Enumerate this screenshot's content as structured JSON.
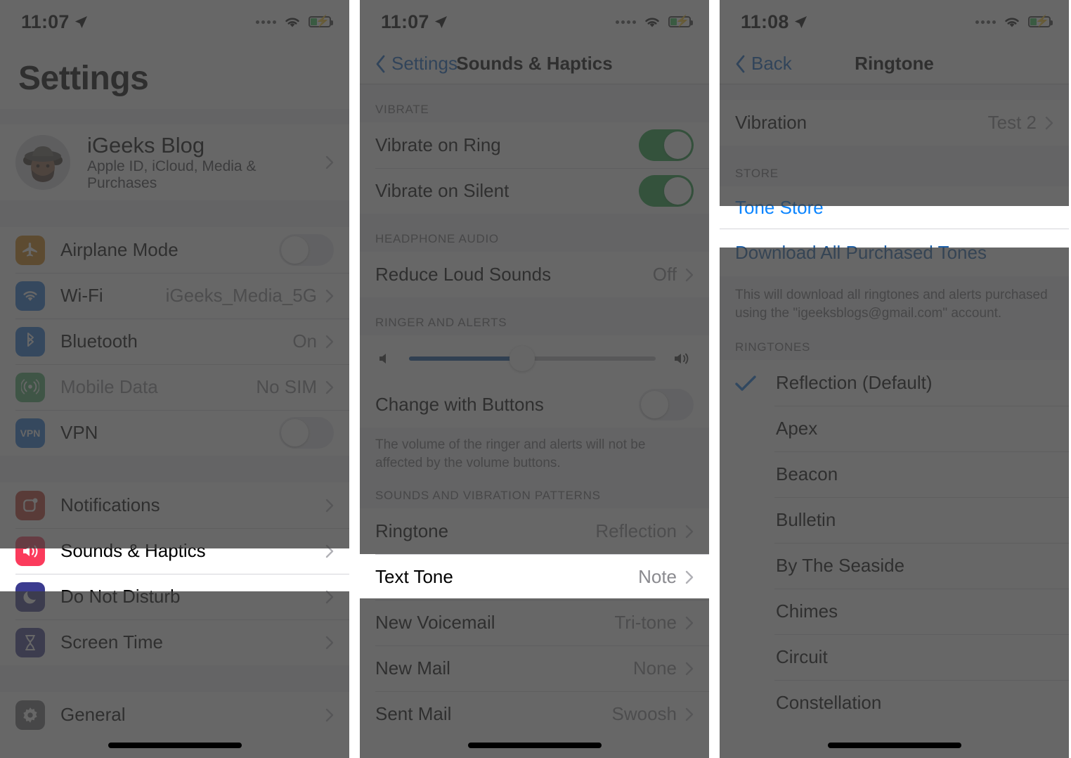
{
  "panels": [
    {
      "id": "settings",
      "status": {
        "time": "11:07",
        "location_icon": "location-arrow-icon",
        "wifi_icon": "wifi-icon",
        "battery_icon": "battery-charging-icon"
      },
      "title": "Settings",
      "account": {
        "name": "iGeeks Blog",
        "subtitle": "Apple ID, iCloud, Media & Purchases",
        "avatar": "memoji-avatar"
      },
      "group1": [
        {
          "label": "Airplane Mode",
          "icon": "airplane-icon",
          "icon_color": "#d2820a",
          "control": "toggle",
          "on": false
        },
        {
          "label": "Wi-Fi",
          "icon": "wifi-icon",
          "icon_color": "#1b72d6",
          "value": "iGeeks_Media_5G",
          "control": "chevron"
        },
        {
          "label": "Bluetooth",
          "icon": "bluetooth-icon",
          "icon_color": "#1b72d6",
          "value": "On",
          "control": "chevron"
        },
        {
          "label": "Mobile Data",
          "icon": "cellular-icon",
          "icon_color": "#4cae6a",
          "value": "No SIM",
          "control": "chevron",
          "disabled": true
        },
        {
          "label": "VPN",
          "icon": "vpn-icon",
          "icon_color": "#1b72d6",
          "control": "toggle",
          "on": false
        }
      ],
      "group2": [
        {
          "label": "Notifications",
          "icon": "notifications-icon",
          "icon_color": "#c0392b",
          "control": "chevron"
        },
        {
          "label": "Sounds & Haptics",
          "icon": "sounds-icon",
          "icon_color": "#fb3b5c",
          "control": "chevron",
          "highlighted": true
        },
        {
          "label": "Do Not Disturb",
          "icon": "moon-icon",
          "icon_color": "#3b3b8f",
          "control": "chevron"
        },
        {
          "label": "Screen Time",
          "icon": "hourglass-icon",
          "icon_color": "#3b3b8f",
          "control": "chevron"
        }
      ],
      "group3": [
        {
          "label": "General",
          "icon": "gear-icon",
          "icon_color": "#6d6d72",
          "control": "chevron"
        }
      ]
    },
    {
      "id": "sounds-haptics",
      "status": {
        "time": "11:07"
      },
      "back_label": "Settings",
      "title": "Sounds & Haptics",
      "sections": [
        {
          "header": "VIBRATE",
          "rows": [
            {
              "label": "Vibrate on Ring",
              "control": "toggle",
              "on": true
            },
            {
              "label": "Vibrate on Silent",
              "control": "toggle",
              "on": true
            }
          ]
        },
        {
          "header": "HEADPHONE AUDIO",
          "rows": [
            {
              "label": "Reduce Loud Sounds",
              "value": "Off",
              "control": "chevron"
            }
          ]
        },
        {
          "header": "RINGER AND ALERTS",
          "slider": {
            "value_percent": 46,
            "low_icon": "speaker-low-icon",
            "high_icon": "speaker-high-icon"
          },
          "rows": [
            {
              "label": "Change with Buttons",
              "control": "toggle",
              "on": false
            }
          ],
          "footnote": "The volume of the ringer and alerts will not be affected by the volume buttons."
        },
        {
          "header": "SOUNDS AND VIBRATION PATTERNS",
          "rows": [
            {
              "label": "Ringtone",
              "value": "Reflection",
              "control": "chevron",
              "highlighted": true
            },
            {
              "label": "Text Tone",
              "value": "Note",
              "control": "chevron"
            },
            {
              "label": "New Voicemail",
              "value": "Tri-tone",
              "control": "chevron"
            },
            {
              "label": "New Mail",
              "value": "None",
              "control": "chevron"
            },
            {
              "label": "Sent Mail",
              "value": "Swoosh",
              "control": "chevron"
            }
          ]
        }
      ]
    },
    {
      "id": "ringtone",
      "status": {
        "time": "11:08"
      },
      "back_label": "Back",
      "title": "Ringtone",
      "vibration_row": {
        "label": "Vibration",
        "value": "Test 2",
        "control": "chevron"
      },
      "store": {
        "header": "STORE",
        "tone_store_label": "Tone Store",
        "download_label": "Download All Purchased Tones",
        "footnote": "This will download all ringtones and alerts purchased using the \"igeeksblogs@gmail.com\" account."
      },
      "ringtones_header": "RINGTONES",
      "ringtones": [
        {
          "name": "Reflection (Default)",
          "selected": true
        },
        {
          "name": "Apex",
          "selected": false
        },
        {
          "name": "Beacon",
          "selected": false
        },
        {
          "name": "Bulletin",
          "selected": false
        },
        {
          "name": "By The Seaside",
          "selected": false
        },
        {
          "name": "Chimes",
          "selected": false
        },
        {
          "name": "Circuit",
          "selected": false
        },
        {
          "name": "Constellation",
          "selected": false
        }
      ]
    }
  ],
  "colors": {
    "accent_blue": "#0a84ff",
    "toggle_on_green": "#1a9e3e",
    "slider_fill": "#0b4f9e",
    "highlight_white": "#ffffff"
  }
}
